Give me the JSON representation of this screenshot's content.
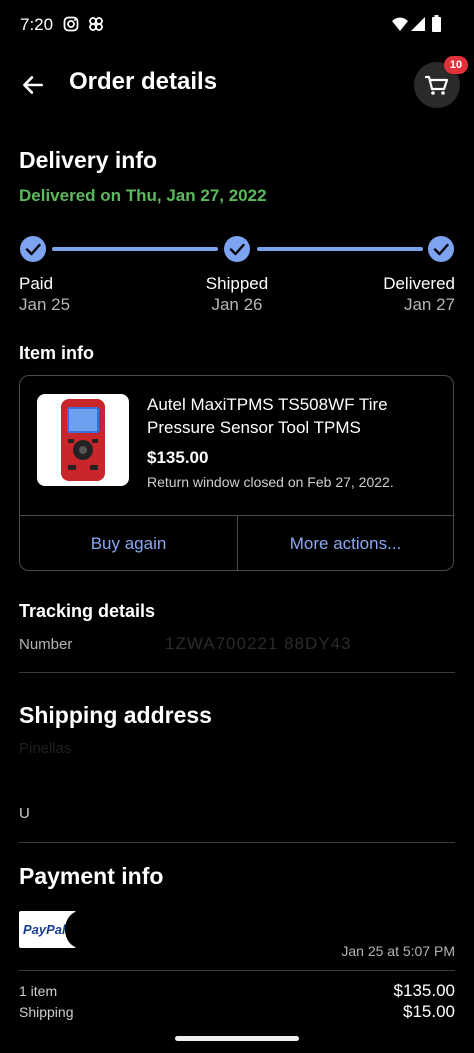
{
  "status_bar": {
    "time": "7:20"
  },
  "header": {
    "title": "Order details",
    "cart_count": "10"
  },
  "delivery": {
    "title": "Delivery info",
    "status": "Delivered on Thu, Jan 27, 2022",
    "steps": [
      {
        "label": "Paid",
        "date": "Jan 25"
      },
      {
        "label": "Shipped",
        "date": "Jan 26"
      },
      {
        "label": "Delivered",
        "date": "Jan 27"
      }
    ]
  },
  "item": {
    "section_title": "Item info",
    "name": "Autel MaxiTPMS TS508WF Tire Pressure Sensor Tool TPMS",
    "price": "$135.00",
    "return_note": "Return window closed on Feb 27, 2022.",
    "buy_again": "Buy again",
    "more_actions": "More actions..."
  },
  "tracking": {
    "title": "Tracking details",
    "number_label": "Number",
    "number_value": "1ZWA700221 88DY43"
  },
  "shipping": {
    "title": "Shipping address",
    "line1": "Pinellas",
    "line2": "U"
  },
  "payment": {
    "title": "Payment info",
    "method_logo_text": "PayPal",
    "date": "Jan 25 at 5:07 PM",
    "items_label": "1 item",
    "items_amount": "$135.00",
    "shipping_label": "Shipping",
    "shipping_amount": "$15.00"
  },
  "colors": {
    "accent": "#7da4f0",
    "success": "#5cb85c",
    "badge": "#e0323a",
    "link": "#8ba8f0"
  }
}
